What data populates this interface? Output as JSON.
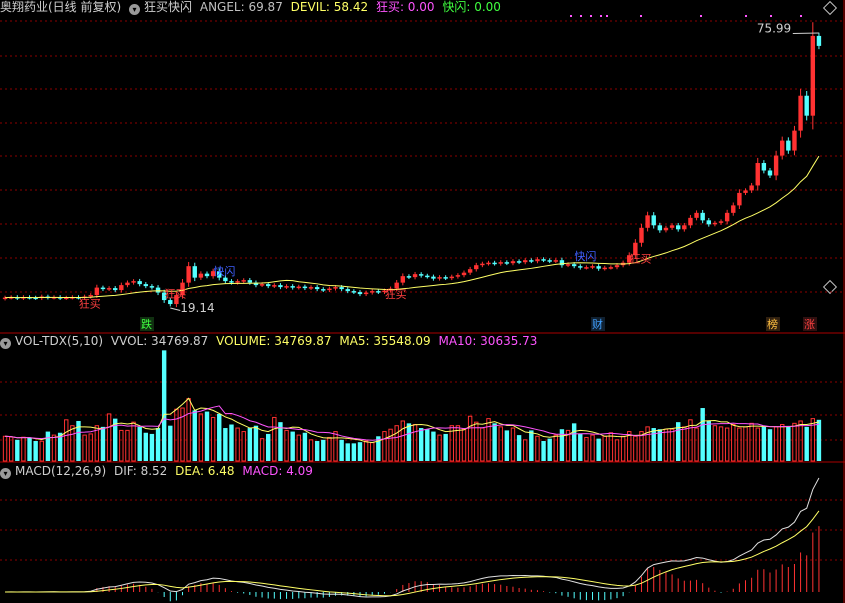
{
  "main_header": {
    "stock_name": "奥翔药业(日线 前复权)",
    "indicator_name": "狂买快闪",
    "angel": "ANGEL: 69.87",
    "devil": "DEVIL: 58.42",
    "kuangmai": "狂买: 0.00",
    "kuaishan": "快闪: 0.00"
  },
  "vol_header": {
    "name": "VOL-TDX(5,10)",
    "vvol": "VVOL: 34769.87",
    "volume": "VOLUME: 34769.87",
    "ma5": "MA5: 35548.09",
    "ma10": "MA10: 30635.73"
  },
  "macd_header": {
    "name": "MACD(12,26,9)",
    "dif": "DIF: 8.52",
    "dea": "DEA: 6.48",
    "macd": "MACD: 4.09"
  },
  "price_labels": {
    "high": "75.99",
    "low": "19.14"
  },
  "signals": [
    {
      "text": "狂买",
      "color": "#ff4040"
    },
    {
      "text": "狂买",
      "color": "#ff4040"
    },
    {
      "text": "快闪",
      "color": "#4060ff"
    },
    {
      "text": "狂买",
      "color": "#ff4040"
    },
    {
      "text": "快闪",
      "color": "#4060ff"
    },
    {
      "text": "狂买",
      "color": "#ff4040"
    }
  ],
  "event_badges": [
    {
      "text": "跌",
      "color": "#40ff40",
      "bg": "#103010"
    },
    {
      "text": "财",
      "color": "#40a0ff",
      "bg": "#102030"
    },
    {
      "text": "榜",
      "color": "#ffc040",
      "bg": "#302010"
    },
    {
      "text": "涨",
      "color": "#ff4040",
      "bg": "#301010"
    }
  ],
  "colors": {
    "up": "#ff3232",
    "down": "#54ffff",
    "ma_yellow": "#ffff66",
    "ma_magenta": "#ff55ff",
    "grid": "#8b0000",
    "angel_text": "#c0c0c0",
    "devil_text": "#ffff66",
    "kuangmai_text": "#ff55ff",
    "kuaishan_text": "#40ff40"
  },
  "chart_data": [
    {
      "type": "candlestick",
      "title": "奥翔药业(日线 前复权)",
      "price_range": [
        17,
        78
      ],
      "annotated_high": 75.99,
      "annotated_low": 19.14,
      "closes": [
        21.5,
        21.6,
        21.4,
        21.6,
        21.5,
        21.4,
        21.7,
        21.5,
        21.6,
        21.4,
        21.5,
        21.6,
        21.5,
        21.7,
        22.0,
        23.5,
        23.2,
        23.4,
        23.0,
        24.0,
        24.5,
        24.8,
        24.2,
        23.8,
        23.5,
        22.5,
        21.0,
        20.2,
        22.0,
        24.5,
        27.8,
        25.5,
        26.3,
        25.8,
        26.8,
        25.5,
        24.8,
        24.5,
        24.8,
        25.0,
        24.5,
        24.0,
        24.2,
        23.8,
        24.0,
        23.6,
        23.8,
        23.5,
        23.7,
        23.4,
        23.6,
        23.2,
        23.0,
        23.3,
        23.6,
        23.2,
        22.8,
        22.6,
        22.2,
        22.5,
        22.8,
        22.6,
        22.9,
        23.3,
        24.5,
        25.8,
        25.6,
        26.2,
        25.9,
        25.7,
        25.3,
        25.6,
        25.4,
        25.7,
        26.0,
        26.5,
        27.2,
        28.0,
        28.3,
        28.5,
        28.3,
        28.6,
        28.4,
        28.8,
        28.6,
        29.0,
        28.8,
        29.2,
        29.0,
        28.8,
        29.0,
        28.0,
        28.2,
        27.8,
        27.5,
        27.6,
        27.8,
        27.3,
        27.5,
        27.6,
        28.0,
        28.5,
        30.0,
        32.5,
        35.5,
        38.0,
        36.0,
        35.0,
        35.5,
        36.0,
        35.2,
        36.0,
        37.5,
        38.5,
        37.0,
        36.2,
        36.5,
        36.8,
        38.5,
        40.0,
        42.5,
        43.0,
        44.0,
        48.5,
        47.0,
        46.0,
        50.0,
        53.0,
        51.0,
        55.0,
        62.0,
        58.0,
        74.0,
        72.0
      ],
      "volumes": [
        10500,
        10200,
        9000,
        10100,
        9800,
        8500,
        8400,
        12500,
        11000,
        12000,
        17500,
        15000,
        17000,
        11000,
        11500,
        15000,
        14500,
        20000,
        18000,
        13000,
        13000,
        16500,
        14500,
        12000,
        11500,
        14000,
        47000,
        15000,
        22000,
        22500,
        26500,
        21500,
        20000,
        21000,
        18500,
        20000,
        14000,
        15500,
        14000,
        12500,
        14000,
        15000,
        9500,
        11500,
        18500,
        16500,
        13000,
        12500,
        11000,
        12000,
        9000,
        8500,
        9000,
        10000,
        12500,
        9000,
        7500,
        7500,
        8000,
        8500,
        7800,
        10500,
        12500,
        13500,
        15000,
        17000,
        16000,
        15500,
        14000,
        13500,
        12500,
        11000,
        11500,
        15000,
        15000,
        13500,
        19000,
        16500,
        14000,
        18000,
        16000,
        14500,
        13000,
        14000,
        11000,
        9000,
        13000,
        10500,
        8500,
        9500,
        11000,
        13500,
        13000,
        16000,
        11500,
        10000,
        11000,
        9500,
        10500,
        12000,
        9000,
        10500,
        12500,
        10500,
        12500,
        14500,
        14000,
        13500,
        13500,
        13500,
        16500,
        14500,
        17500,
        14000,
        22500,
        17000,
        15000,
        14500,
        14000,
        15500,
        14000,
        14500,
        16000,
        14000,
        15000,
        13500,
        14500,
        15500,
        14500,
        16000,
        17000,
        14500,
        18000,
        17500,
        16500,
        15000,
        17000,
        12000,
        16500,
        17500,
        17000,
        16500,
        18500,
        15500,
        16500,
        17000
      ],
      "macd_series": [
        "DIF",
        "DEA",
        "MACD"
      ]
    }
  ]
}
